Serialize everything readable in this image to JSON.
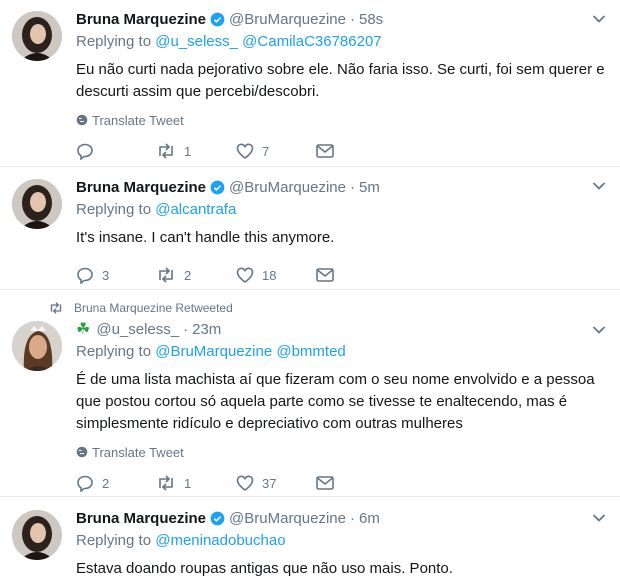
{
  "tweets": [
    {
      "name": "Bruna Marquezine",
      "handle": "@BruMarquezine",
      "time": "58s",
      "replying_label": "Replying to",
      "mentions": [
        "@u_seless_",
        "@CamilaC36786207"
      ],
      "text": "Eu não curti nada pejorativo sobre ele. Não faria isso. Se curti, foi sem querer e descurti assim que percebi/descobri.",
      "translate": "Translate Tweet",
      "reply_count": "",
      "retweet_count": "1",
      "like_count": "7"
    },
    {
      "name": "Bruna Marquezine",
      "handle": "@BruMarquezine",
      "time": "5m",
      "replying_label": "Replying to",
      "mentions": [
        "@alcantrafa"
      ],
      "text": "It's insane. I can't handle this anymore.",
      "reply_count": "3",
      "retweet_count": "2",
      "like_count": "18"
    },
    {
      "retweeted_by": "Bruna Marquezine Retweeted",
      "name": "",
      "handle": "@u_seless_",
      "time": "23m",
      "replying_label": "Replying to",
      "mentions": [
        "@BruMarquezine",
        "@bmmted"
      ],
      "text": "É de uma lista machista aí que fizeram com o seu nome envolvido e a pessoa que postou cortou só aquela parte como se tivesse te enaltecendo, mas é simplesmente ridículo e depreciativo com outras mulheres",
      "translate": "Translate Tweet",
      "reply_count": "2",
      "retweet_count": "1",
      "like_count": "37"
    },
    {
      "name": "Bruna Marquezine",
      "handle": "@BruMarquezine",
      "time": "6m",
      "replying_label": "Replying to",
      "mentions": [
        "@meninadobuchao"
      ],
      "text": "Estava doando roupas antigas que não uso mais. Ponto."
    }
  ],
  "icons": {
    "verified": "verified-badge-icon",
    "reply": "reply-icon",
    "retweet": "retweet-icon",
    "like": "heart-icon",
    "dm": "envelope-icon",
    "more": "chevron-down-icon",
    "translate": "globe-icon",
    "clover": "clover-emoji"
  },
  "colors": {
    "link": "#1da1f2",
    "secondary": "#657786",
    "verified": "#1da1f2"
  }
}
